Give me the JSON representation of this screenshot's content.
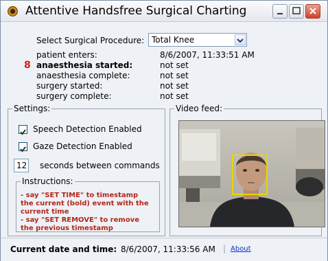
{
  "window": {
    "title": "Attentive Handsfree Surgical Charting"
  },
  "procedure": {
    "label": "Select Surgical Procedure:",
    "selected": "Total Knee"
  },
  "events": {
    "current_marker": "8",
    "rows": [
      {
        "label": "patient enters:",
        "value": "8/6/2007, 11:33:51 AM"
      },
      {
        "label": "anaesthesia started:",
        "value": "not set"
      },
      {
        "label": "anaesthesia complete:",
        "value": "not set"
      },
      {
        "label": "surgery started:",
        "value": "not set"
      },
      {
        "label": "surgery complete:",
        "value": "not set"
      }
    ]
  },
  "settings": {
    "title": "Settings:",
    "speech_label": "Speech Detection Enabled",
    "gaze_label": "Gaze Detection Enabled",
    "seconds_value": "12",
    "seconds_label": "seconds between commands"
  },
  "instructions": {
    "title": "Instructions:",
    "lines": [
      "- say \"SET TIME\" to timestamp",
      "the current (bold) event with the",
      "current time",
      "- say \"SET REMOVE\" to remove",
      "the previous timestamp"
    ]
  },
  "video": {
    "title": "Video feed:"
  },
  "status": {
    "label": "Current date and time:",
    "value": "8/6/2007, 11:33:56 AM",
    "separator": "|",
    "about": "About"
  },
  "colors": {
    "highlight_box": "#e6d600",
    "event_marker": "#d0201a",
    "instruction_text": "#b2261a"
  }
}
